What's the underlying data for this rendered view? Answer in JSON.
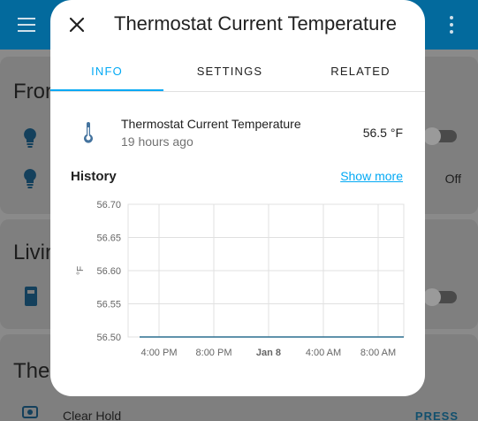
{
  "background": {
    "cards": [
      {
        "title": "Fron"
      },
      {
        "title": "Livin"
      },
      {
        "title": "Ther"
      }
    ],
    "off_label": "Off",
    "clear_hold_label": "Clear Hold",
    "press_label": "PRESS"
  },
  "dialog": {
    "title": "Thermostat Current Temperature",
    "tabs": [
      {
        "label": "INFO"
      },
      {
        "label": "SETTINGS"
      },
      {
        "label": "RELATED"
      }
    ],
    "active_tab": "INFO",
    "entity": {
      "name": "Thermostat Current Temperature",
      "last_changed": "19 hours ago",
      "state": "56.5 °F"
    },
    "history_title": "History",
    "show_more_label": "Show more"
  },
  "colors": {
    "accent": "#03a9f4",
    "line": "#2c6e8f",
    "appbar": "#036a9d"
  },
  "chart_data": {
    "type": "line",
    "ylabel": "°F",
    "ylim": [
      56.5,
      56.7
    ],
    "y_ticks": [
      "56.70",
      "56.65",
      "56.60",
      "56.55",
      "56.50"
    ],
    "x_ticks": [
      "4:00 PM",
      "8:00 PM",
      "Jan 8",
      "4:00 AM",
      "8:00 AM"
    ],
    "series": [
      {
        "x": [
          "4:00 PM",
          "8:00 AM"
        ],
        "values": [
          56.5,
          56.5
        ]
      }
    ]
  }
}
